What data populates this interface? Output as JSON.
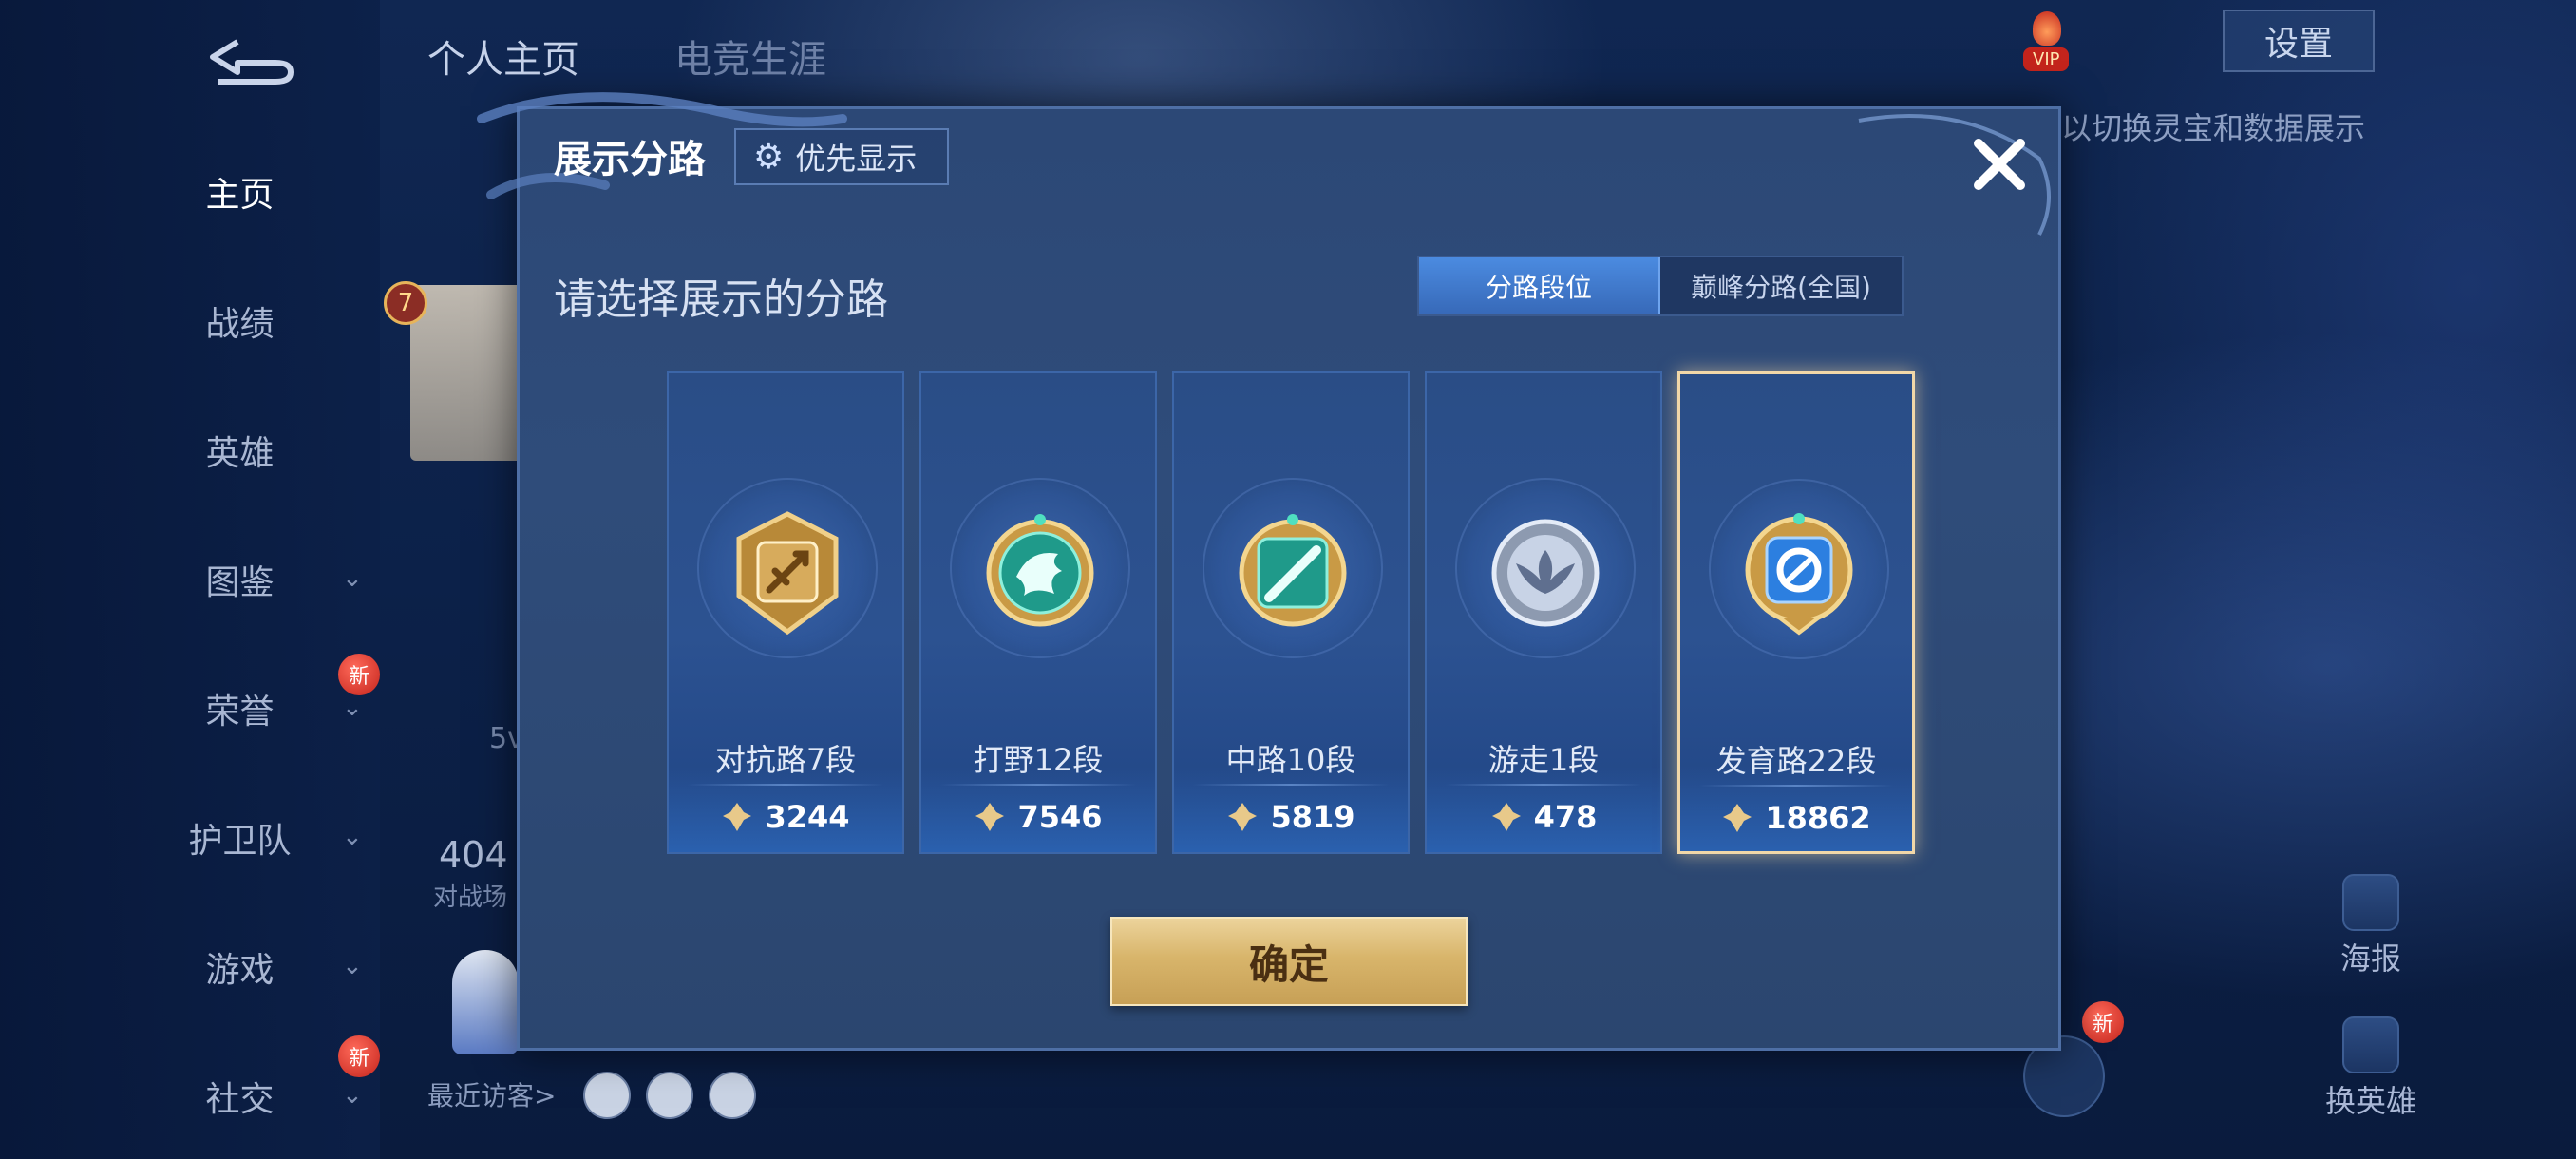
{
  "background": {
    "top_tabs": [
      "个人主页",
      "电竞生涯"
    ],
    "side_nav": [
      {
        "label": "主页",
        "active": true,
        "chevron": false,
        "new": false
      },
      {
        "label": "战绩",
        "active": false,
        "chevron": false,
        "new": false
      },
      {
        "label": "英雄",
        "active": false,
        "chevron": false,
        "new": false
      },
      {
        "label": "图鉴",
        "active": false,
        "chevron": true,
        "new": false
      },
      {
        "label": "荣誉",
        "active": false,
        "chevron": true,
        "new": true
      },
      {
        "label": "护卫队",
        "active": false,
        "chevron": true,
        "new": false
      },
      {
        "label": "游戏",
        "active": false,
        "chevron": true,
        "new": false
      },
      {
        "label": "社交",
        "active": false,
        "chevron": true,
        "new": true
      }
    ],
    "new_badge_text": "新",
    "level_badge": "7",
    "settings_label": "设置",
    "vip_label": "VIP",
    "hint_text": "以切换灵宝和数据展示",
    "poster_label": "海报",
    "change_hero_label": "换英雄",
    "recent_visitors_label": "最近访客>",
    "partial_text_a": "404",
    "partial_text_b": "对战场",
    "partial_text_c": "5v"
  },
  "modal": {
    "title": "展示分路",
    "priority_button": "优先显示",
    "subtitle": "请选择展示的分路",
    "toggle": {
      "option_a": "分路段位",
      "option_b": "巅峰分路(全国)",
      "selected": "option_a"
    },
    "cards": [
      {
        "label": "对抗路7段",
        "points": "3244",
        "emblem": "sword-emblem-icon",
        "selected": false
      },
      {
        "label": "打野12段",
        "points": "7546",
        "emblem": "dragon-emblem-icon",
        "selected": false
      },
      {
        "label": "中路10段",
        "points": "5819",
        "emblem": "mid-lane-emblem-icon",
        "selected": false
      },
      {
        "label": "游走1段",
        "points": "478",
        "emblem": "wings-emblem-icon",
        "selected": false
      },
      {
        "label": "发育路22段",
        "points": "18862",
        "emblem": "target-emblem-icon",
        "selected": true
      }
    ],
    "confirm_button": "确定"
  },
  "colors": {
    "accent_blue": "#3769b8",
    "gold_button": "#d8b56b",
    "selected_border": "#f1d7a8",
    "new_badge": "#c4241c"
  }
}
